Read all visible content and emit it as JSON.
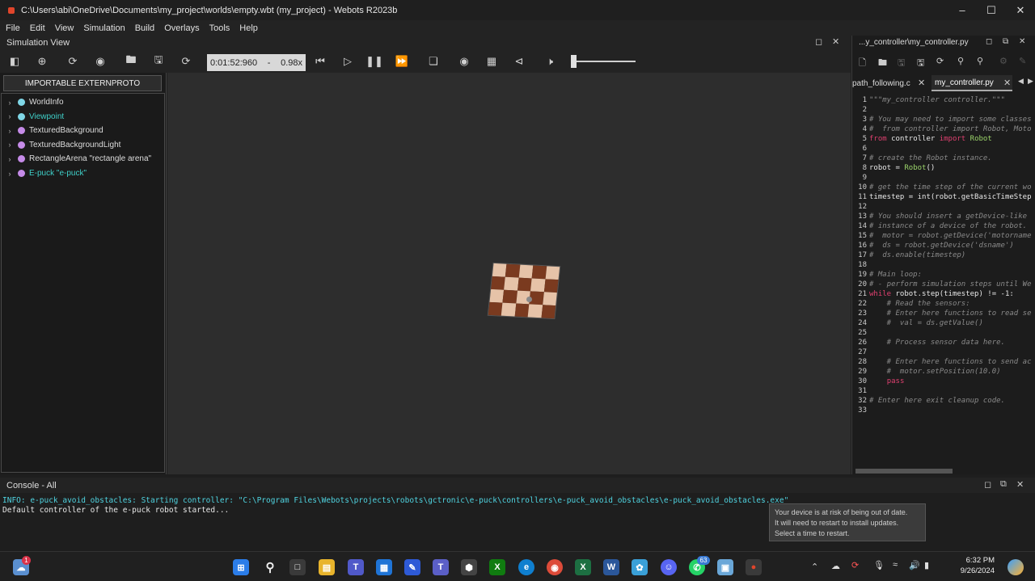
{
  "window": {
    "title": "C:\\Users\\abi\\OneDrive\\Documents\\my_project\\worlds\\empty.wbt (my_project) - Webots R2023b"
  },
  "menu": [
    "File",
    "Edit",
    "View",
    "Simulation",
    "Build",
    "Overlays",
    "Tools",
    "Help"
  ],
  "sim_view": {
    "title": "Simulation View",
    "time": "0:01:52:960",
    "dash": "-",
    "speed": "0.98x"
  },
  "scene_tree": {
    "button": "IMPORTABLE EXTERNPROTO",
    "nodes": [
      {
        "label": "WorldInfo",
        "color": "#7fd6e6",
        "text_color": "#dddddd"
      },
      {
        "label": "Viewpoint",
        "color": "#7fd6e6",
        "text_color": "#3fd0c9"
      },
      {
        "label": "TexturedBackground",
        "color": "#c58be8",
        "text_color": "#dddddd"
      },
      {
        "label": "TexturedBackgroundLight",
        "color": "#c58be8",
        "text_color": "#dddddd"
      },
      {
        "label": "RectangleArena \"rectangle arena\"",
        "color": "#c58be8",
        "text_color": "#dddddd"
      },
      {
        "label": "E-puck \"e-puck\"",
        "color": "#c58be8",
        "text_color": "#3fd0c9"
      }
    ]
  },
  "editor": {
    "title": "...y_controller\\my_controller.py",
    "tabs": [
      {
        "label": "path_following.c"
      },
      {
        "label": "my_controller.py"
      }
    ],
    "lines": [
      "\"\"\"my_controller controller.\"\"\"",
      "",
      "# You may need to import some classes",
      "#  from controller import Robot, Moto",
      "from controller import Robot",
      "",
      "# create the Robot instance.",
      "robot = Robot()",
      "",
      "# get the time step of the current wo",
      "timestep = int(robot.getBasicTimeStep",
      "",
      "# You should insert a getDevice-like",
      "# instance of a device of the robot.",
      "#  motor = robot.getDevice('motorname",
      "#  ds = robot.getDevice('dsname')",
      "#  ds.enable(timestep)",
      "",
      "# Main loop:",
      "# - perform simulation steps until We",
      "while robot.step(timestep) != -1:",
      "    # Read the sensors:",
      "    # Enter here functions to read se",
      "    #  val = ds.getValue()",
      "",
      "    # Process sensor data here.",
      "",
      "    # Enter here functions to send ac",
      "    #  motor.setPosition(10.0)",
      "    pass",
      "",
      "# Enter here exit cleanup code.",
      ""
    ]
  },
  "console": {
    "title": "Console - All",
    "lines": [
      "INFO: e-puck_avoid_obstacles: Starting controller: \"C:\\Program Files\\Webots\\projects\\robots\\gctronic\\e-puck\\controllers\\e-puck_avoid_obstacles\\e-puck_avoid_obstacles.exe\"",
      "Default controller of the e-puck robot started..."
    ]
  },
  "toast": {
    "lines": [
      "Your device is at risk of being out of date.",
      "It will need to restart to install updates.",
      "Select a time to restart."
    ]
  },
  "taskbar": {
    "time": "6:32 PM",
    "date": "9/26/2024",
    "badge_weather": "1",
    "badge_whatsapp": "63"
  }
}
